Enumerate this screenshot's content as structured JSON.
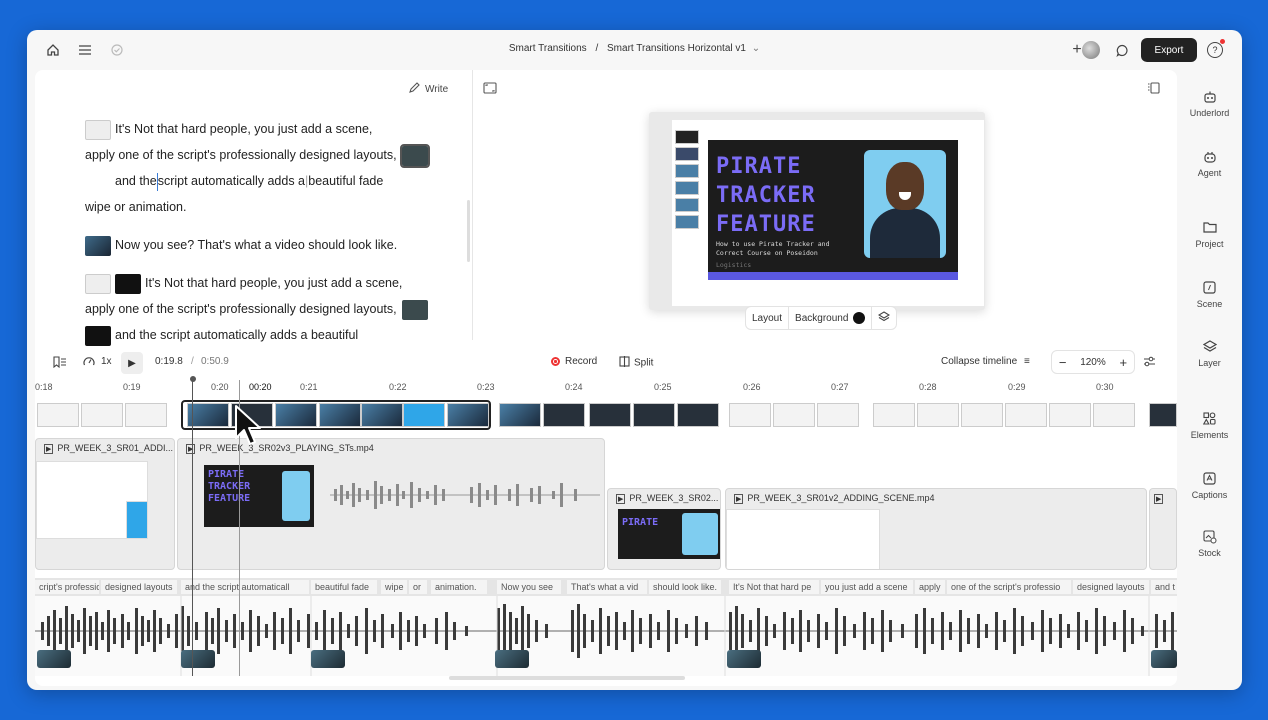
{
  "topbar": {
    "project": "Smart Transitions",
    "separator": "/",
    "composition": "Smart Transitions Horizontal v1",
    "chevron": "⌄",
    "export_label": "Export",
    "help_label": "?"
  },
  "script": {
    "write_label": "Write",
    "lines": [
      "It's Not that hard people, you just add a scene,",
      "apply one of the script's professionally designed layouts,",
      "and the",
      "script automatically adds a",
      "beautiful fade",
      "wipe or animation.",
      "Now you see? That's what a video should look like.",
      "It's Not that hard people, you just add a scene,",
      "apply one of the script's professionally designed layouts,",
      "and the script automatically adds a beautiful"
    ]
  },
  "preview": {
    "slide_title": "PIRATE\nTRACKER\nFEATURE",
    "slide_subtitle": "How to use Pirate Tracker and Correct Course on Poseidon",
    "slide_footer": "Logistics",
    "layout_label": "Layout",
    "background_label": "Background"
  },
  "transport": {
    "speed": "1x",
    "current_time": "0:19.8",
    "time_sep": "/",
    "total_time": "0:50.9",
    "record_label": "Record",
    "split_label": "Split",
    "collapse_label": "Collapse timeline",
    "zoom": "120%",
    "zoom_minus": "−",
    "zoom_plus": "+"
  },
  "ruler": [
    "0:18",
    "0:19",
    "0:20",
    "00:20",
    "0:21",
    "0:22",
    "0:23",
    "0:24",
    "0:25",
    "0:26",
    "0:27",
    "0:28",
    "0:29",
    "0:30"
  ],
  "clips": [
    {
      "name": "PR_WEEK_3_SR01_ADDI..."
    },
    {
      "name": "PR_WEEK_3_SR02v3_PLAYING_STs.mp4"
    },
    {
      "name": "PR_WEEK_3_SR02..."
    },
    {
      "name": "PR_WEEK_3_SR01v2_ADDING_SCENE.mp4"
    }
  ],
  "mini_slide_titles": [
    "PIRATE\nTRACKER\nFEATURE",
    "PIRATE"
  ],
  "words": [
    "cript's professio",
    "designed layouts",
    "and the script automaticall",
    "beautiful fade",
    "wipe",
    "or",
    "animation.",
    "Now you see",
    "That's what a vid",
    "should look like.",
    "It's Not that hard pe",
    "you just add a scene",
    "apply",
    "one of the script's professio",
    "designed layouts",
    "and t"
  ],
  "sidebar": [
    {
      "label": "Underlord",
      "icon": "robot-icon"
    },
    {
      "label": "Agent",
      "icon": "agent-icon"
    },
    {
      "label": "Project",
      "icon": "folder-icon"
    },
    {
      "label": "Scene",
      "icon": "scene-icon"
    },
    {
      "label": "Layer",
      "icon": "layers-icon"
    },
    {
      "label": "Elements",
      "icon": "elements-icon"
    },
    {
      "label": "Captions",
      "icon": "captions-icon"
    },
    {
      "label": "Stock",
      "icon": "stock-icon"
    }
  ],
  "colors": {
    "background": "#1768d6",
    "export_button": "#222222",
    "slide_title": "#7b6cf6",
    "record": "#e33333",
    "cursor": "#3a7bd5"
  }
}
